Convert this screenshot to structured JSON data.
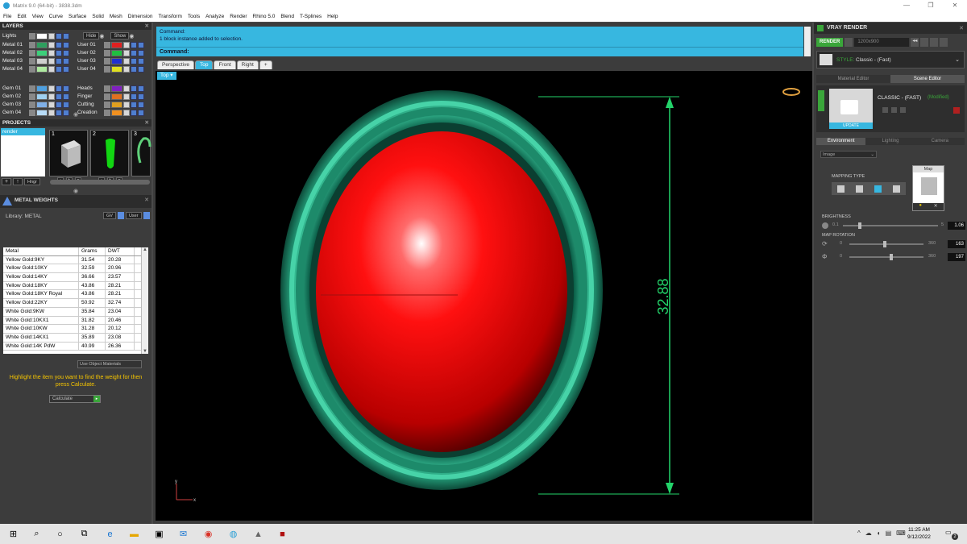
{
  "window": {
    "title": "Matrix 9.0 (64-bit) - 3838.3dm",
    "controls": [
      "—",
      "❐",
      "✕"
    ]
  },
  "menu": [
    "File",
    "Edit",
    "View",
    "Curve",
    "Surface",
    "Solid",
    "Mesh",
    "Dimension",
    "Transform",
    "Tools",
    "Analyze",
    "Render",
    "Rhino 5.0",
    "Blend",
    "T-Splines",
    "Help"
  ],
  "layers": {
    "title": "LAYERS",
    "lights_label": "Lights",
    "hide_label": "Hide",
    "show_label": "Show",
    "left": [
      {
        "name": "Metal 01",
        "color": "#2e9f5e"
      },
      {
        "name": "Metal 02",
        "color": "#3ccf7a"
      },
      {
        "name": "Metal 03",
        "color": "#cfcfcf"
      },
      {
        "name": "Metal 04",
        "color": "#aeeaa0"
      },
      {
        "name": "Gem 01",
        "color": "#4ea0e0"
      },
      {
        "name": "Gem 02",
        "color": "#9fd0f0"
      },
      {
        "name": "Gem 03",
        "color": "#7fb0e8"
      },
      {
        "name": "Gem 04",
        "color": "#b8dcf8"
      }
    ],
    "right": [
      {
        "name": "User 01",
        "color": "#e02020"
      },
      {
        "name": "User 02",
        "color": "#20c040"
      },
      {
        "name": "User 03",
        "color": "#2030d0"
      },
      {
        "name": "User 04",
        "color": "#e0e020"
      },
      {
        "name": "Heads",
        "color": "#8020c0"
      },
      {
        "name": "Finger",
        "color": "#e07020"
      },
      {
        "name": "Cutting",
        "color": "#e0a020"
      },
      {
        "name": "Creation",
        "color": "#f09020"
      }
    ]
  },
  "projects": {
    "title": "PROJECTS",
    "list_item": "render",
    "thumbs": [
      "1",
      "2",
      "3"
    ],
    "hinge_label": "Hngr"
  },
  "metal_weights": {
    "title": "METAL WEIGHTS",
    "library_label": "Library: METAL",
    "lib_buttons": [
      "GV",
      "User"
    ],
    "columns": [
      "Metal",
      "Grams",
      "DWT"
    ],
    "rows": [
      [
        "Yellow Gold:9KY",
        "31.54",
        "20.28"
      ],
      [
        "Yellow Gold:10KY",
        "32.59",
        "20.96"
      ],
      [
        "Yellow Gold:14KY",
        "36.66",
        "23.57"
      ],
      [
        "Yellow Gold:18KY",
        "43.86",
        "28.21"
      ],
      [
        "Yellow Gold:18KY Royal",
        "43.86",
        "28.21"
      ],
      [
        "Yellow Gold:22KY",
        "50.92",
        "32.74"
      ],
      [
        "White Gold:9KW",
        "35.84",
        "23.04"
      ],
      [
        "White Gold:10KX1",
        "31.82",
        "20.46"
      ],
      [
        "White Gold:10KW",
        "31.28",
        "20.12"
      ],
      [
        "White Gold:14KX1",
        "35.89",
        "23.08"
      ],
      [
        "White Gold:14K PdW",
        "40.99",
        "26.36"
      ]
    ],
    "use_object_materials": "Use Object Materials",
    "hint": "Highlight the item you want to find the weight for then press Calculate.",
    "calculate_label": "Calculate"
  },
  "command": {
    "history_line1": "Command:",
    "history_line2": "1 block instance added to selection.",
    "prompt": "Command:"
  },
  "view_tabs": [
    "Perspective",
    "Top",
    "Front",
    "Right",
    "+"
  ],
  "viewport": {
    "label": "Top",
    "dimension": "32.88",
    "axis_y": "y",
    "axis_x": "x"
  },
  "vray": {
    "title": "VRAY RENDER",
    "render_label": "RENDER",
    "resolution": "1200x900",
    "style_label": "STYLE:",
    "style_value": "Classic - (Fast)",
    "tabs": [
      "Material Editor",
      "Scene Editor"
    ],
    "preset_name": "CLASSIC - (FAST)",
    "preset_status": "(Modified)",
    "update_label": "UPDATE",
    "env_tabs": [
      "Environment",
      "Lighting",
      "Camera"
    ],
    "env_select": "Image",
    "mapping_type": "MAPPING TYPE",
    "map_label": "Map",
    "brightness_label": "BRIGHTNESS",
    "brightness_min": "0.1",
    "brightness_max": "5",
    "brightness_value": "1.06",
    "map_rotation_label": "MAP ROTATION",
    "rot1_min": "0",
    "rot1_max": "360",
    "rot1_value": "163",
    "rot2_min": "0",
    "rot2_max": "360",
    "rot2_value": "197"
  },
  "taskbar": {
    "time": "11:25 AM",
    "date": "9/12/2022",
    "notif_count": "2",
    "icons": [
      "windows-icon",
      "search-icon",
      "cortana-icon",
      "task-view-icon",
      "edge-icon",
      "file-explorer-icon",
      "store-icon",
      "mail-icon",
      "chrome-icon",
      "app-icon",
      "rhino-icon",
      "matrix-icon"
    ]
  }
}
